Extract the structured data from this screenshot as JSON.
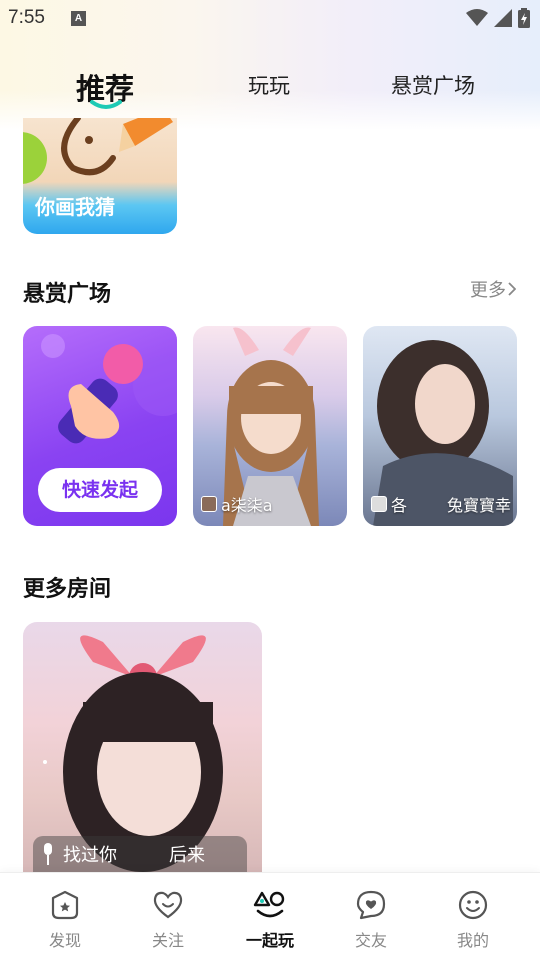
{
  "status_bar": {
    "time": "7:55",
    "notification_badge": "A"
  },
  "tabs": [
    {
      "label": "推荐",
      "active": true
    },
    {
      "label": "玩玩",
      "active": false
    },
    {
      "label": "悬赏广场",
      "active": false
    }
  ],
  "featured_card": {
    "label": "你画我猜"
  },
  "bounty_section": {
    "title": "悬赏广场",
    "more_label": "更多",
    "quick_card": {
      "button_label": "快速发起"
    },
    "cards": [
      {
        "caption": "a柒柒a"
      },
      {
        "caption_left": "各",
        "caption_right": "兔寶寶幸"
      }
    ]
  },
  "rooms_section": {
    "title": "更多房间",
    "room": {
      "caption_left": "找过你",
      "caption_right": "后来"
    }
  },
  "bottom_nav": [
    {
      "label": "发现",
      "icon": "discover-icon",
      "active": false
    },
    {
      "label": "关注",
      "icon": "heart-icon",
      "active": false
    },
    {
      "label": "一起玩",
      "icon": "play-together-icon",
      "active": true
    },
    {
      "label": "交友",
      "icon": "chat-heart-icon",
      "active": false
    },
    {
      "label": "我的",
      "icon": "smile-face-icon",
      "active": false
    }
  ],
  "colors": {
    "accent": "#7b36ee",
    "tab_underline": "#1ecab4"
  }
}
